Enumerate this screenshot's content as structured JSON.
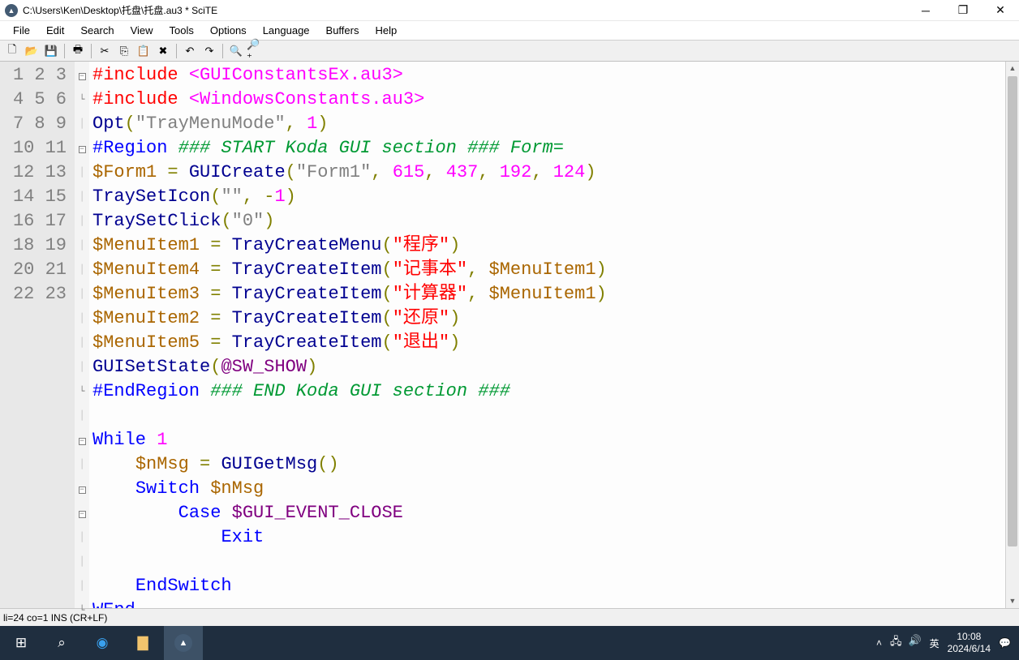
{
  "window": {
    "title": "C:\\Users\\Ken\\Desktop\\托盘\\托盘.au3 * SciTE"
  },
  "menus": [
    "File",
    "Edit",
    "Search",
    "View",
    "Tools",
    "Options",
    "Language",
    "Buffers",
    "Help"
  ],
  "toolbar_icons": [
    {
      "name": "new-icon",
      "glyph": "🗋"
    },
    {
      "name": "open-icon",
      "glyph": "📂"
    },
    {
      "name": "save-icon",
      "glyph": "💾"
    },
    {
      "sep": true
    },
    {
      "name": "print-icon",
      "glyph": "🖶"
    },
    {
      "sep": true
    },
    {
      "name": "cut-icon",
      "glyph": "✂"
    },
    {
      "name": "copy-icon",
      "glyph": "⎘"
    },
    {
      "name": "paste-icon",
      "glyph": "📋"
    },
    {
      "name": "delete-icon",
      "glyph": "✖"
    },
    {
      "sep": true
    },
    {
      "name": "undo-icon",
      "glyph": "↶"
    },
    {
      "name": "redo-icon",
      "glyph": "↷"
    },
    {
      "sep": true
    },
    {
      "name": "find-icon",
      "glyph": "🔍"
    },
    {
      "name": "replace-icon",
      "glyph": "🔎⁺"
    }
  ],
  "line_numbers": [
    "1",
    "2",
    "3",
    "4",
    "5",
    "6",
    "7",
    "8",
    "9",
    "10",
    "11",
    "12",
    "13",
    "14",
    "15",
    "16",
    "17",
    "18",
    "19",
    "20",
    "21",
    "22",
    "23"
  ],
  "fold_marks": [
    "box-minus",
    "end",
    "",
    "box-minus",
    "",
    "",
    "",
    "",
    "",
    "",
    "",
    "",
    "",
    "end",
    "",
    "box-minus",
    "",
    "box-minus",
    "box-minus",
    "",
    "",
    "",
    "end"
  ],
  "code_lines": [
    [
      {
        "c": "c-red",
        "t": "#include"
      },
      {
        "t": " "
      },
      {
        "c": "c-mag",
        "t": "<GUIConstantsEx.au3>"
      }
    ],
    [
      {
        "c": "c-red",
        "t": "#include"
      },
      {
        "t": " "
      },
      {
        "c": "c-mag",
        "t": "<WindowsConstants.au3>"
      }
    ],
    [
      {
        "c": "c-navy",
        "t": "Opt"
      },
      {
        "c": "c-olive",
        "t": "("
      },
      {
        "c": "c-gray",
        "t": "\"TrayMenuMode\""
      },
      {
        "c": "c-olive",
        "t": ","
      },
      {
        "t": " "
      },
      {
        "c": "c-mag",
        "t": "1"
      },
      {
        "c": "c-olive",
        "t": ")"
      }
    ],
    [
      {
        "c": "c-blue",
        "t": "#Region"
      },
      {
        "t": " "
      },
      {
        "c": "c-green-it",
        "t": "### START Koda GUI section ### Form="
      }
    ],
    [
      {
        "c": "c-brown",
        "t": "$Form1"
      },
      {
        "t": " "
      },
      {
        "c": "c-olive",
        "t": "="
      },
      {
        "t": " "
      },
      {
        "c": "c-navy",
        "t": "GUICreate"
      },
      {
        "c": "c-olive",
        "t": "("
      },
      {
        "c": "c-gray",
        "t": "\"Form1\""
      },
      {
        "c": "c-olive",
        "t": ","
      },
      {
        "t": " "
      },
      {
        "c": "c-mag",
        "t": "615"
      },
      {
        "c": "c-olive",
        "t": ","
      },
      {
        "t": " "
      },
      {
        "c": "c-mag",
        "t": "437"
      },
      {
        "c": "c-olive",
        "t": ","
      },
      {
        "t": " "
      },
      {
        "c": "c-mag",
        "t": "192"
      },
      {
        "c": "c-olive",
        "t": ","
      },
      {
        "t": " "
      },
      {
        "c": "c-mag",
        "t": "124"
      },
      {
        "c": "c-olive",
        "t": ")"
      }
    ],
    [
      {
        "c": "c-navy",
        "t": "TraySetIcon"
      },
      {
        "c": "c-olive",
        "t": "("
      },
      {
        "c": "c-gray",
        "t": "\"\""
      },
      {
        "c": "c-olive",
        "t": ","
      },
      {
        "t": " "
      },
      {
        "c": "c-olive",
        "t": "-"
      },
      {
        "c": "c-mag",
        "t": "1"
      },
      {
        "c": "c-olive",
        "t": ")"
      }
    ],
    [
      {
        "c": "c-navy",
        "t": "TraySetClick"
      },
      {
        "c": "c-olive",
        "t": "("
      },
      {
        "c": "c-gray",
        "t": "\"0\""
      },
      {
        "c": "c-olive",
        "t": ")"
      }
    ],
    [
      {
        "c": "c-brown",
        "t": "$MenuItem1"
      },
      {
        "t": " "
      },
      {
        "c": "c-olive",
        "t": "="
      },
      {
        "t": " "
      },
      {
        "c": "c-navy",
        "t": "TrayCreateMenu"
      },
      {
        "c": "c-olive",
        "t": "("
      },
      {
        "c": "c-red",
        "t": "\"程序\""
      },
      {
        "c": "c-olive",
        "t": ")"
      }
    ],
    [
      {
        "c": "c-brown",
        "t": "$MenuItem4"
      },
      {
        "t": " "
      },
      {
        "c": "c-olive",
        "t": "="
      },
      {
        "t": " "
      },
      {
        "c": "c-navy",
        "t": "TrayCreateItem"
      },
      {
        "c": "c-olive",
        "t": "("
      },
      {
        "c": "c-red",
        "t": "\"记事本\""
      },
      {
        "c": "c-olive",
        "t": ","
      },
      {
        "t": " "
      },
      {
        "c": "c-brown",
        "t": "$MenuItem1"
      },
      {
        "c": "c-olive",
        "t": ")"
      }
    ],
    [
      {
        "c": "c-brown",
        "t": "$MenuItem3"
      },
      {
        "t": " "
      },
      {
        "c": "c-olive",
        "t": "="
      },
      {
        "t": " "
      },
      {
        "c": "c-navy",
        "t": "TrayCreateItem"
      },
      {
        "c": "c-olive",
        "t": "("
      },
      {
        "c": "c-red",
        "t": "\"计算器\""
      },
      {
        "c": "c-olive",
        "t": ","
      },
      {
        "t": " "
      },
      {
        "c": "c-brown",
        "t": "$MenuItem1"
      },
      {
        "c": "c-olive",
        "t": ")"
      }
    ],
    [
      {
        "c": "c-brown",
        "t": "$MenuItem2"
      },
      {
        "t": " "
      },
      {
        "c": "c-olive",
        "t": "="
      },
      {
        "t": " "
      },
      {
        "c": "c-navy",
        "t": "TrayCreateItem"
      },
      {
        "c": "c-olive",
        "t": "("
      },
      {
        "c": "c-red",
        "t": "\"还原\""
      },
      {
        "c": "c-olive",
        "t": ")"
      }
    ],
    [
      {
        "c": "c-brown",
        "t": "$MenuItem5"
      },
      {
        "t": " "
      },
      {
        "c": "c-olive",
        "t": "="
      },
      {
        "t": " "
      },
      {
        "c": "c-navy",
        "t": "TrayCreateItem"
      },
      {
        "c": "c-olive",
        "t": "("
      },
      {
        "c": "c-red",
        "t": "\"退出\""
      },
      {
        "c": "c-olive",
        "t": ")"
      }
    ],
    [
      {
        "c": "c-navy",
        "t": "GUISetState"
      },
      {
        "c": "c-olive",
        "t": "("
      },
      {
        "c": "c-purple",
        "t": "@SW_SHOW"
      },
      {
        "c": "c-olive",
        "t": ")"
      }
    ],
    [
      {
        "c": "c-blue",
        "t": "#EndRegion"
      },
      {
        "t": " "
      },
      {
        "c": "c-green-it",
        "t": "### END Koda GUI section ###"
      }
    ],
    [],
    [
      {
        "c": "c-blue",
        "t": "While"
      },
      {
        "t": " "
      },
      {
        "c": "c-mag",
        "t": "1"
      }
    ],
    [
      {
        "t": "    "
      },
      {
        "c": "c-brown",
        "t": "$nMsg"
      },
      {
        "t": " "
      },
      {
        "c": "c-olive",
        "t": "="
      },
      {
        "t": " "
      },
      {
        "c": "c-navy",
        "t": "GUIGetMsg"
      },
      {
        "c": "c-olive",
        "t": "()"
      }
    ],
    [
      {
        "t": "    "
      },
      {
        "c": "c-blue",
        "t": "Switch"
      },
      {
        "t": " "
      },
      {
        "c": "c-brown",
        "t": "$nMsg"
      }
    ],
    [
      {
        "t": "        "
      },
      {
        "c": "c-blue",
        "t": "Case"
      },
      {
        "t": " "
      },
      {
        "c": "c-purple",
        "t": "$GUI_EVENT_CLOSE"
      }
    ],
    [
      {
        "t": "            "
      },
      {
        "c": "c-blue",
        "t": "Exit"
      }
    ],
    [],
    [
      {
        "t": "    "
      },
      {
        "c": "c-blue",
        "t": "EndSwitch"
      }
    ],
    [
      {
        "c": "c-blue",
        "t": "WEnd"
      }
    ]
  ],
  "status": "li=24 co=1 INS (CR+LF)",
  "taskbar": {
    "ime": "英",
    "time": "10:08",
    "date": "2024/6/14"
  }
}
